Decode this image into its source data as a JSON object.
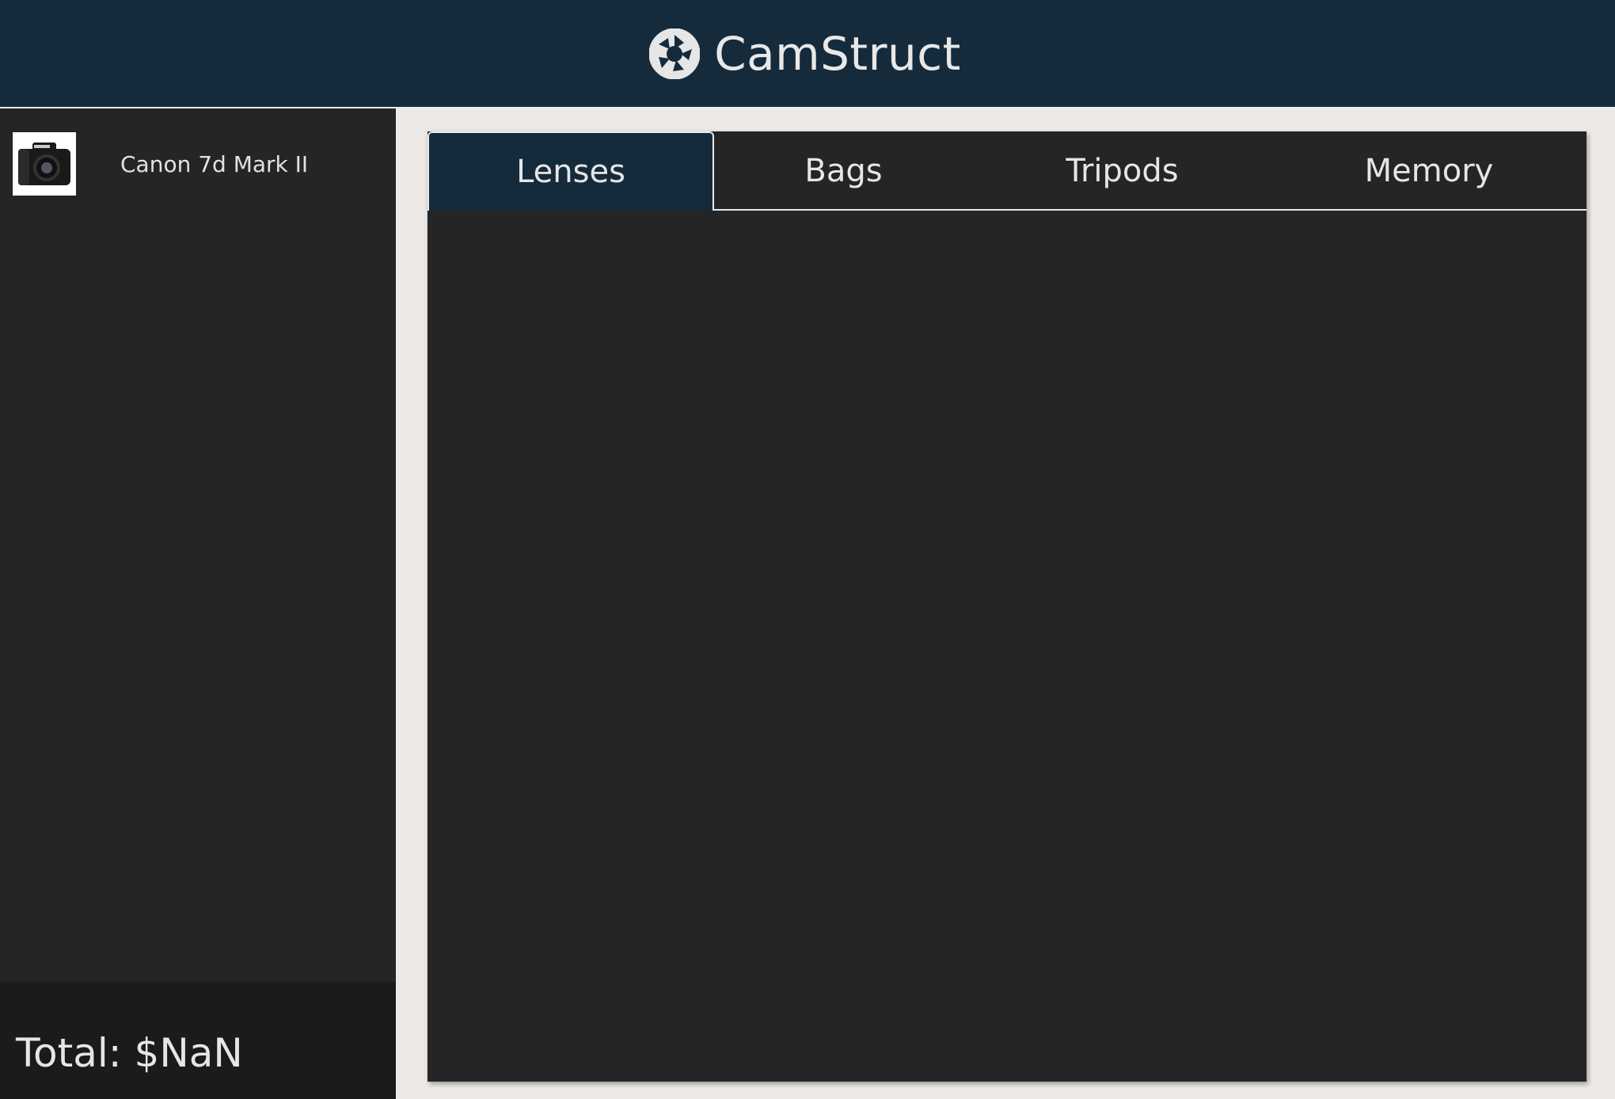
{
  "header": {
    "brand_name": "CamStruct",
    "logo_icon": "camera-aperture-icon"
  },
  "sidebar": {
    "cart_items": [
      {
        "name": "Canon 7d Mark II",
        "thumbnail_icon": "camera-icon"
      }
    ],
    "total_label": "Total: $NaN"
  },
  "main": {
    "tabs": [
      {
        "label": "Lenses",
        "active": true
      },
      {
        "label": "Bags",
        "active": false
      },
      {
        "label": "Tripods",
        "active": false
      },
      {
        "label": "Memory",
        "active": false
      }
    ]
  },
  "colors": {
    "header_bg": "#152b3c",
    "page_bg": "#ece9e6",
    "panel_bg": "#252527",
    "total_bg": "#1b1b1c",
    "text": "#e6e6e6"
  }
}
